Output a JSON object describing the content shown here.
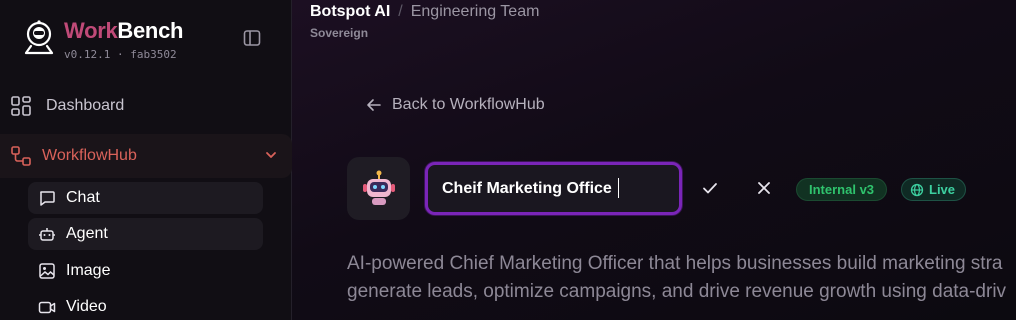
{
  "brand": {
    "name_part1": "Work",
    "name_part2": "Bench",
    "version": "v0.12.1 · fab3502"
  },
  "sidebar": {
    "items": [
      {
        "label": "Dashboard",
        "icon": "dashboard-grid-icon"
      },
      {
        "label": "WorkflowHub",
        "icon": "workflow-icon",
        "active": true,
        "expanded": true
      }
    ],
    "sub_items": [
      {
        "label": "Chat",
        "icon": "chat-icon"
      },
      {
        "label": "Agent",
        "icon": "robot-icon"
      },
      {
        "label": "Image",
        "icon": "image-icon"
      },
      {
        "label": "Video",
        "icon": "video-icon"
      }
    ]
  },
  "header": {
    "org": "Botspot AI",
    "separator": "/",
    "team": "Engineering Team",
    "sub": "Sovereign"
  },
  "main": {
    "back_label": "Back to WorkflowHub",
    "agent_name_value": "Cheif Marketing Office",
    "badges": {
      "internal": "Internal v3",
      "live": "Live"
    },
    "description_line1": "AI-powered Chief Marketing Officer that helps businesses build marketing stra",
    "description_line2": "generate leads, optimize campaigns, and drive revenue growth using data-driv"
  },
  "colors": {
    "accent_purple": "#7a25b8",
    "active_red": "#d9625a",
    "badge_green": "#2fc36d",
    "live_teal": "#3dd0a0"
  }
}
